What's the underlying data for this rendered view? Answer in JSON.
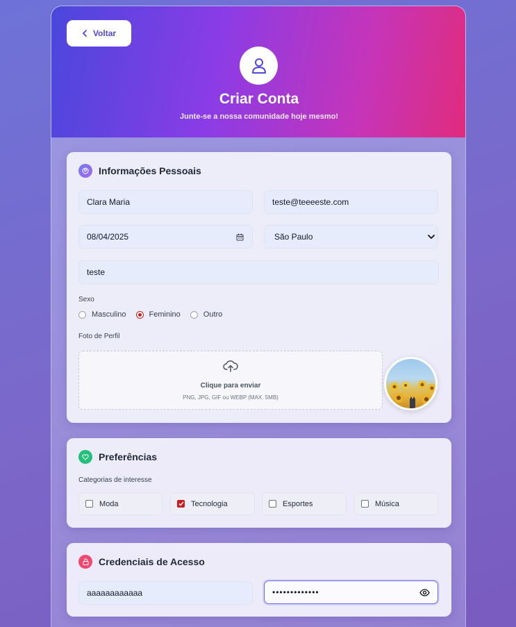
{
  "header": {
    "back_label": "Voltar",
    "title": "Criar Conta",
    "subtitle": "Junte-se a nossa comunidade hoje mesmo!"
  },
  "personal": {
    "title": "Informações Pessoais",
    "name_value": "Clara Maria",
    "email_value": "teste@teeeeste.com",
    "date_value": "08/04/2025",
    "city_value": "São Paulo",
    "bio_value": "teste",
    "gender_label": "Sexo",
    "gender_options": [
      "Masculino",
      "Feminino",
      "Outro"
    ],
    "gender_selected": "Feminino",
    "photo_label": "Foto de Perfil",
    "upload_text": "Clique para enviar",
    "upload_hint": "PNG, JPG, GIF ou WEBP (MAX. 5MB)"
  },
  "preferences": {
    "title": "Preferências",
    "categories_label": "Categorias de interesse",
    "categories": [
      {
        "label": "Moda",
        "checked": false
      },
      {
        "label": "Tecnologia",
        "checked": true
      },
      {
        "label": "Esportes",
        "checked": false
      },
      {
        "label": "Música",
        "checked": false
      }
    ]
  },
  "credentials": {
    "title": "Credenciais de Acesso",
    "username_value": "aaaaaaaaaaaa",
    "password_mask": "•••••••••••••"
  },
  "colors": {
    "accent": "#4f46e5",
    "checked": "#c81e1e",
    "personal_icon": "#7c6cf0",
    "preferences_icon": "#22c07a",
    "credentials_icon": "#ef4970"
  },
  "icons": [
    "chevron-left-icon",
    "user-icon",
    "user-circle-icon",
    "calendar-icon",
    "chevron-down-icon",
    "upload-cloud-icon",
    "heart-icon",
    "lock-icon",
    "eye-icon"
  ]
}
